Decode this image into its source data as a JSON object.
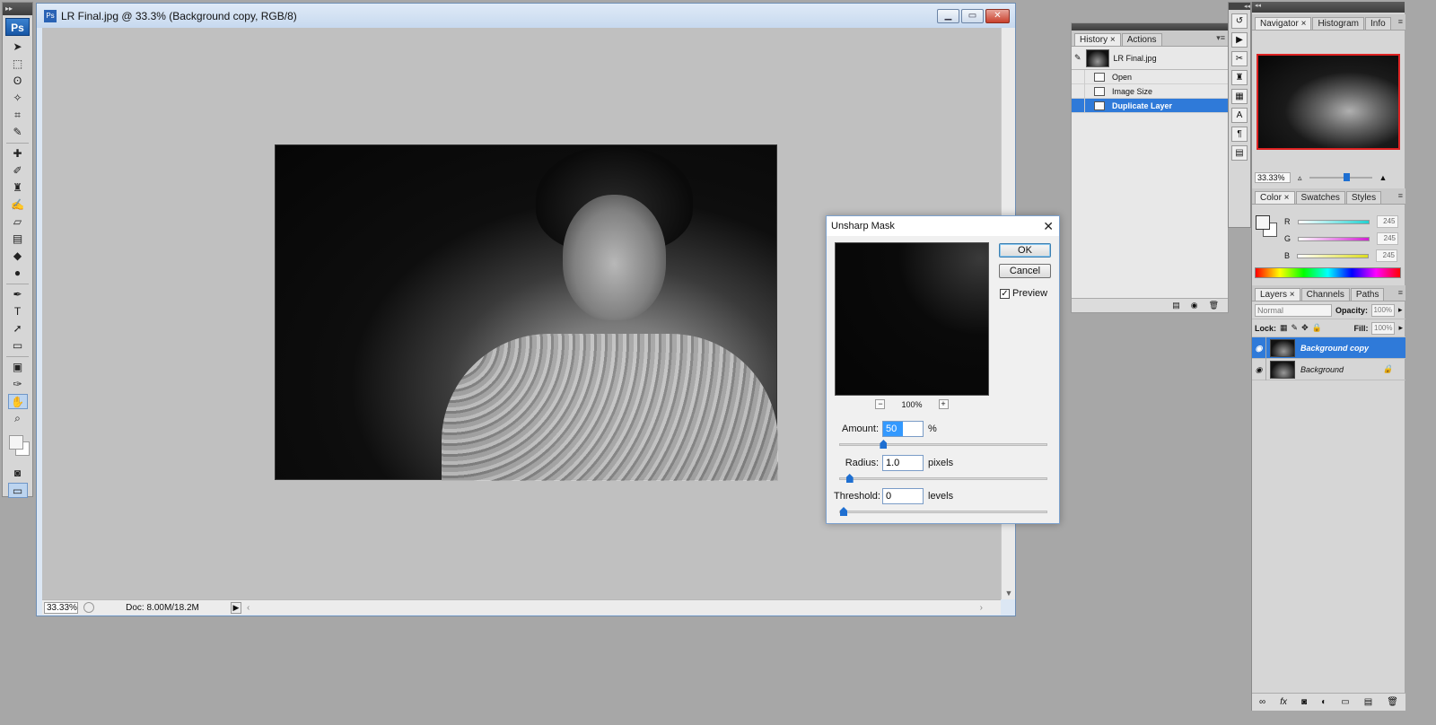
{
  "tools": {
    "logo": "Ps",
    "items": [
      {
        "name": "move-tool",
        "glyph": "➤"
      },
      {
        "name": "marquee-tool",
        "glyph": "⬚"
      },
      {
        "name": "lasso-tool",
        "glyph": "ʘ"
      },
      {
        "name": "magic-wand-tool",
        "glyph": "✧"
      },
      {
        "name": "crop-tool",
        "glyph": "⌗"
      },
      {
        "name": "eyedropper-tool",
        "glyph": "✎"
      },
      {
        "name": "healing-brush-tool",
        "glyph": "✚"
      },
      {
        "name": "brush-tool",
        "glyph": "✐"
      },
      {
        "name": "clone-stamp-tool",
        "glyph": "♜"
      },
      {
        "name": "history-brush-tool",
        "glyph": "✍"
      },
      {
        "name": "eraser-tool",
        "glyph": "▱"
      },
      {
        "name": "gradient-tool",
        "glyph": "▤"
      },
      {
        "name": "blur-tool",
        "glyph": "◆"
      },
      {
        "name": "dodge-tool",
        "glyph": "●"
      },
      {
        "name": "pen-tool",
        "glyph": "✒"
      },
      {
        "name": "type-tool",
        "glyph": "T"
      },
      {
        "name": "path-selection-tool",
        "glyph": "➚"
      },
      {
        "name": "shape-tool",
        "glyph": "▭"
      },
      {
        "name": "notes-tool",
        "glyph": "▣"
      },
      {
        "name": "eyedropper2-tool",
        "glyph": "✑"
      },
      {
        "name": "hand-tool",
        "glyph": "✋"
      },
      {
        "name": "zoom-tool",
        "glyph": "⌕"
      }
    ]
  },
  "document": {
    "title": "LR Final.jpg @ 33.3% (Background copy, RGB/8)",
    "icon": "ps-doc-icon",
    "zoom": "33.33%",
    "doc_info": "Doc: 8.00M/18.2M"
  },
  "unsharp_mask": {
    "title": "Unsharp Mask",
    "ok_label": "OK",
    "cancel_label": "Cancel",
    "preview_label": "Preview",
    "preview_checked": true,
    "preview_zoom": "100%",
    "zoom_minus": "−",
    "zoom_plus": "+",
    "amount": {
      "label": "Amount:",
      "value": "50",
      "unit": "%",
      "level": 0.2
    },
    "radius": {
      "label": "Radius:",
      "value": "1.0",
      "unit": "pixels",
      "level": 0.03
    },
    "threshold": {
      "label": "Threshold:",
      "value": "0",
      "unit": "levels",
      "level": 0.0
    }
  },
  "history": {
    "tabs": [
      "History",
      "Actions"
    ],
    "snapshot": "LR Final.jpg",
    "items": [
      {
        "label": "Open",
        "selected": false
      },
      {
        "label": "Image Size",
        "selected": false
      },
      {
        "label": "Duplicate Layer",
        "selected": true
      }
    ]
  },
  "navigator": {
    "tabs": [
      "Navigator",
      "Histogram",
      "Info"
    ],
    "zoom": "33.33%"
  },
  "color": {
    "tabs": [
      "Color",
      "Swatches",
      "Styles"
    ],
    "channels": [
      {
        "label": "R",
        "value": "245",
        "color": "#21d1d1"
      },
      {
        "label": "G",
        "value": "245",
        "color": "#d11fd1"
      },
      {
        "label": "B",
        "value": "245",
        "color": "#dddd1f"
      }
    ]
  },
  "layers": {
    "tabs": [
      "Layers",
      "Channels",
      "Paths"
    ],
    "blend_mode": "Normal",
    "opacity_label": "Opacity:",
    "opacity": "100%",
    "lock_label": "Lock:",
    "fill_label": "Fill:",
    "fill": "100%",
    "items": [
      {
        "label": "Background copy",
        "selected": true
      },
      {
        "label": "Background",
        "selected": false
      }
    ]
  },
  "accent_color": "#2f7ad9"
}
